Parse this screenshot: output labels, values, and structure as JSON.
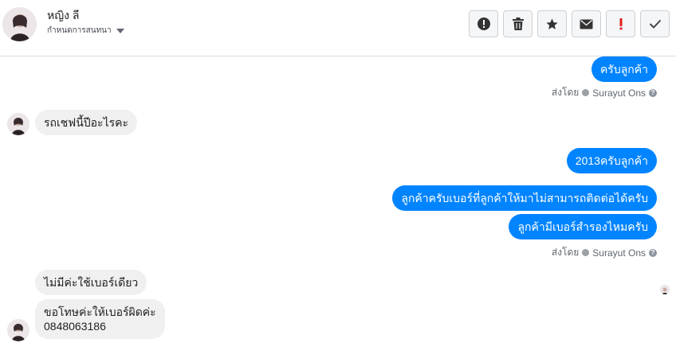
{
  "header": {
    "contact_name": "หญิง ลี",
    "subtitle": "กำหนดการสนทนา",
    "actions": [
      {
        "name": "report-button",
        "icon": "alert-circle-icon"
      },
      {
        "name": "delete-button",
        "icon": "trash-icon"
      },
      {
        "name": "star-button",
        "icon": "star-icon"
      },
      {
        "name": "mark-unread-button",
        "icon": "envelope-icon"
      },
      {
        "name": "important-button",
        "icon": "exclamation-icon"
      },
      {
        "name": "done-button",
        "icon": "check-icon"
      }
    ]
  },
  "messages": [
    {
      "direction": "out",
      "text": "ครับลูกค้า"
    },
    {
      "direction": "in",
      "text": "รถเชฟนี้ปีอะไรคะ"
    },
    {
      "direction": "out",
      "text": "2013ครับลูกค้า"
    },
    {
      "direction": "out",
      "text": "ลูกค้าครับเบอร์ที่ลูกค้าให้มาไม่สามารถติดต่อได้ครับ"
    },
    {
      "direction": "out",
      "text": "ลูกค้ามีเบอร์สำรองไหมครับ"
    },
    {
      "direction": "in",
      "text": "ไม่มีค่ะใช้เบอร์เดียว"
    },
    {
      "direction": "in",
      "text_line1": "ขอโทษค่ะให้เบอร์ผิดค่ะ",
      "text_line2": "0848063186"
    }
  ],
  "sent_by": {
    "prefix": "ส่งโดย",
    "agent": "Surayut Ons",
    "help": "?"
  },
  "colors": {
    "outgoing_bubble": "#0084ff",
    "incoming_bubble": "#f1f0f0",
    "important": "#e02020"
  }
}
